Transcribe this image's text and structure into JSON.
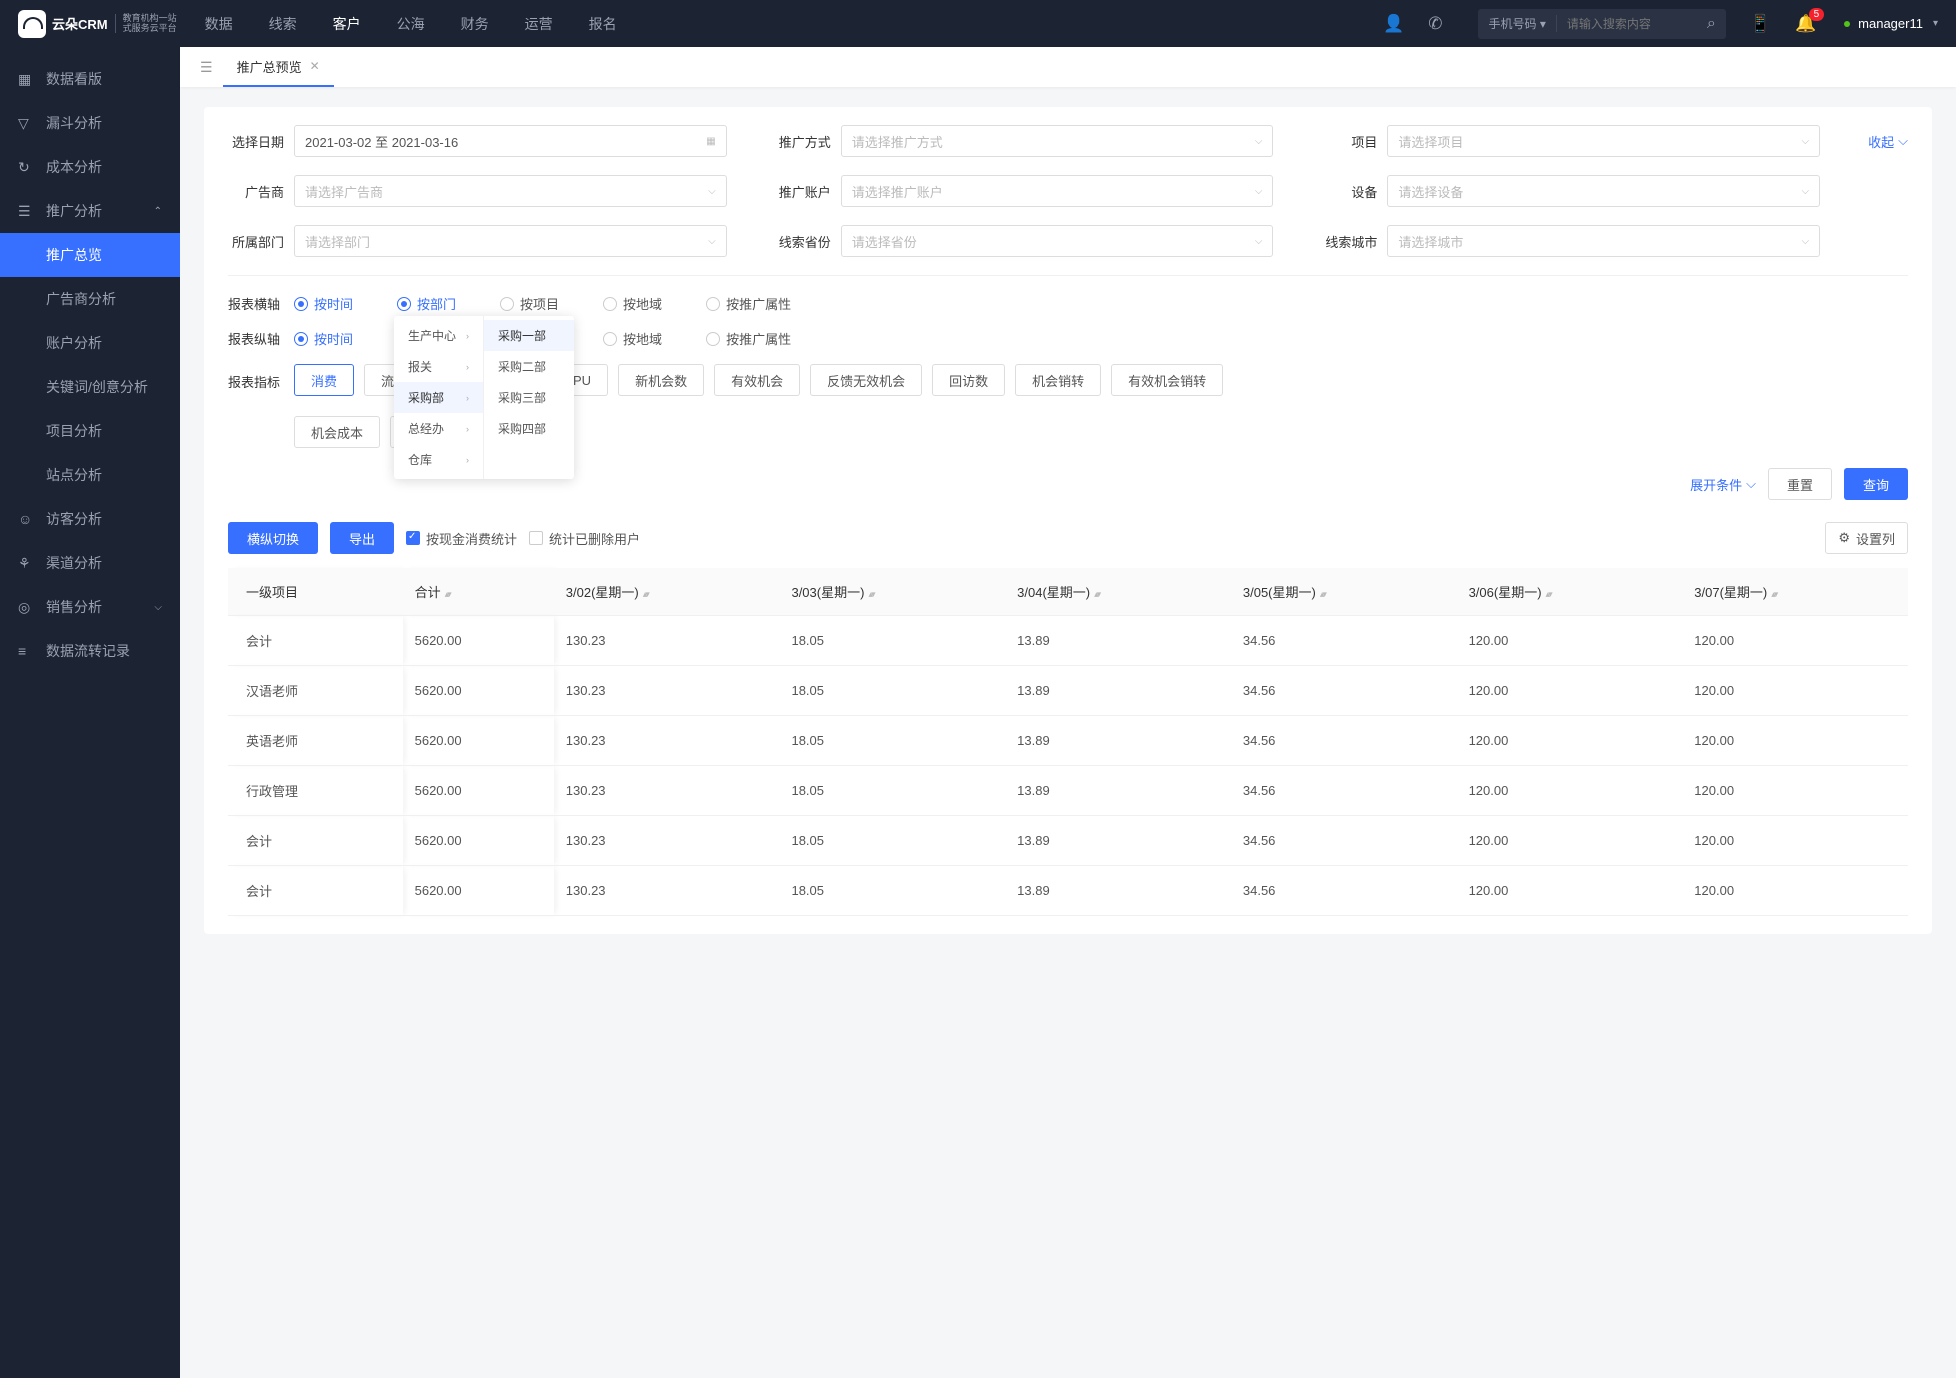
{
  "brand": {
    "name": "云朵CRM",
    "sub1": "教育机构一站",
    "sub2": "式服务云平台"
  },
  "topnav": [
    "数据",
    "线索",
    "客户",
    "公海",
    "财务",
    "运营",
    "报名"
  ],
  "topnav_active_index": 2,
  "search": {
    "type": "手机号码",
    "placeholder": "请输入搜索内容"
  },
  "badge_count": "5",
  "user": {
    "name": "manager11"
  },
  "sidebar": [
    {
      "icon": "▦",
      "label": "数据看版"
    },
    {
      "icon": "▽",
      "label": "漏斗分析"
    },
    {
      "icon": "↻",
      "label": "成本分析"
    },
    {
      "icon": "☰",
      "label": "推广分析",
      "expanded": true,
      "children": [
        {
          "label": "推广总览",
          "active": true
        },
        {
          "label": "广告商分析"
        },
        {
          "label": "账户分析"
        },
        {
          "label": "关键词/创意分析"
        },
        {
          "label": "项目分析"
        },
        {
          "label": "站点分析"
        }
      ]
    },
    {
      "icon": "☺",
      "label": "访客分析"
    },
    {
      "icon": "⚘",
      "label": "渠道分析"
    },
    {
      "icon": "◎",
      "label": "销售分析",
      "chev": true
    },
    {
      "icon": "≡",
      "label": "数据流转记录"
    }
  ],
  "tab": {
    "title": "推广总预览"
  },
  "filters": {
    "date_label": "选择日期",
    "date_value": "2021-03-02  至  2021-03-16",
    "promo_method": {
      "label": "推广方式",
      "placeholder": "请选择推广方式"
    },
    "project": {
      "label": "项目",
      "placeholder": "请选择项目"
    },
    "collapse": "收起",
    "advertiser": {
      "label": "广告商",
      "placeholder": "请选择广告商"
    },
    "promo_account": {
      "label": "推广账户",
      "placeholder": "请选择推广账户"
    },
    "device": {
      "label": "设备",
      "placeholder": "请选择设备"
    },
    "dept": {
      "label": "所属部门",
      "placeholder": "请选择部门"
    },
    "clue_province": {
      "label": "线索省份",
      "placeholder": "请选择省份"
    },
    "clue_city": {
      "label": "线索城市",
      "placeholder": "请选择城市"
    }
  },
  "axis": {
    "h_label": "报表横轴",
    "v_label": "报表纵轴",
    "options": [
      "按时间",
      "按部门",
      "按项目",
      "按地域",
      "按推广属性"
    ],
    "h_selected": 1,
    "h_orig_selected": 0,
    "v_selected": 0
  },
  "dropdown": {
    "col1": [
      "生产中心",
      "报关",
      "采购部",
      "总经办",
      "仓库"
    ],
    "col1_hl": 2,
    "col2": [
      "采购一部",
      "采购二部",
      "采购三部",
      "采购四部"
    ],
    "col2_hl": 0
  },
  "metrics": {
    "label": "报表指标",
    "items": [
      "消费",
      "流",
      "",
      "",
      "ARPU",
      "新机会数",
      "有效机会",
      "反馈无效机会",
      "回访数",
      "机会销转",
      "有效机会销转",
      "机会成本",
      "",
      "",
      ""
    ],
    "active_index": 0
  },
  "actions": {
    "expand": "展开条件",
    "reset": "重置",
    "query": "查询"
  },
  "tools": {
    "switch": "横纵切换",
    "export": "导出",
    "cash_stats": "按现金消费统计",
    "deleted_users": "统计已删除用户",
    "settings": "设置列"
  },
  "table": {
    "headers": [
      "一级项目",
      "合计",
      "3/02(星期一)",
      "3/03(星期一)",
      "3/04(星期一)",
      "3/05(星期一)",
      "3/06(星期一)",
      "3/07(星期一)"
    ],
    "rows": [
      [
        "会计",
        "5620.00",
        "130.23",
        "18.05",
        "13.89",
        "34.56",
        "120.00",
        "120.00"
      ],
      [
        "汉语老师",
        "5620.00",
        "130.23",
        "18.05",
        "13.89",
        "34.56",
        "120.00",
        "120.00"
      ],
      [
        "英语老师",
        "5620.00",
        "130.23",
        "18.05",
        "13.89",
        "34.56",
        "120.00",
        "120.00"
      ],
      [
        "行政管理",
        "5620.00",
        "130.23",
        "18.05",
        "13.89",
        "34.56",
        "120.00",
        "120.00"
      ],
      [
        "会计",
        "5620.00",
        "130.23",
        "18.05",
        "13.89",
        "34.56",
        "120.00",
        "120.00"
      ],
      [
        "会计",
        "5620.00",
        "130.23",
        "18.05",
        "13.89",
        "34.56",
        "120.00",
        "120.00"
      ]
    ]
  }
}
